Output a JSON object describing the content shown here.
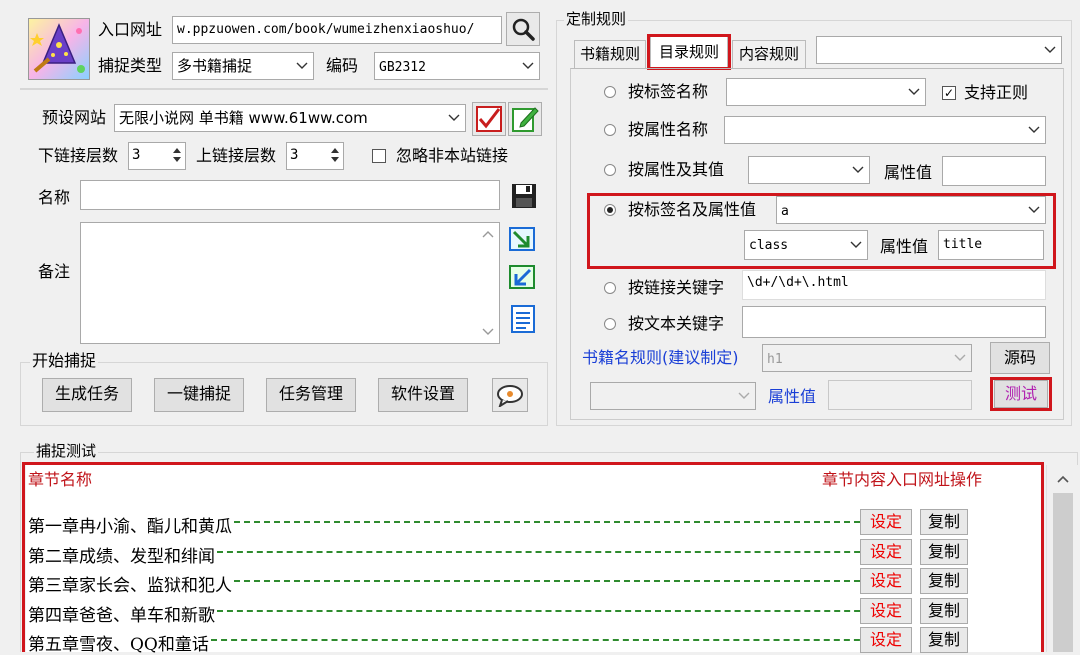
{
  "left": {
    "url_label": "入口网址",
    "url_value": "w.ppzuowen.com/book/wumeizhenxiaoshuo/",
    "capture_type_label": "捕捉类型",
    "capture_type_value": "多书籍捕捉",
    "encoding_label": "编码",
    "encoding_value": "GB2312",
    "preset_label": "预设网站",
    "preset_value": "无限小说网 单书籍 www.61ww.com",
    "down_depth_label": "下链接层数",
    "down_depth_value": "3",
    "up_depth_label": "上链接层数",
    "up_depth_value": "3",
    "ignore_offsite_label": "忽略非本站链接",
    "name_label": "名称",
    "name_value": "",
    "notes_label": "备注",
    "start_group_label": "开始捕捉",
    "buttons": {
      "generate": "生成任务",
      "one_click": "一键捕捉",
      "task_mgmt": "任务管理",
      "settings": "软件设置"
    }
  },
  "rules": {
    "group_label": "定制规则",
    "tabs": [
      "书籍规则",
      "目录规则",
      "内容规则"
    ],
    "active_tab": 1,
    "tab_combo_value": "",
    "by_tag_name": "按标签名称",
    "support_regex": "支持正则",
    "by_attr_name": "按属性名称",
    "by_attr_and_value": "按属性及其值",
    "attr_value_label": "属性值",
    "by_tag_and_attr": "按标签名及属性值",
    "tag_value": "a",
    "attr_name_value": "class",
    "attr_value_value": "title",
    "by_link_keyword": "按链接关键字",
    "link_keyword_value": "\\d+/\\d+\\.html",
    "by_text_keyword": "按文本关键字",
    "text_keyword_value": "",
    "book_name_rule_label": "书籍名规则(建议制定)",
    "book_name_rule_value": "h1",
    "book_attr_value_label": "属性值",
    "source_button": "源码",
    "test_button": "测试"
  },
  "test": {
    "group_label": "捕捉测试",
    "header_left": "章节名称",
    "header_right": "章节内容入口网址操作",
    "set_label": "设定",
    "copy_label": "复制",
    "rows": [
      "第一章冉小渝、酯儿和黄瓜",
      "第二章成绩、发型和绯闻",
      "第三章家长会、监狱和犯人",
      "第四章爸爸、单车和新歌",
      "第五章雪夜、QQ和童话"
    ]
  },
  "colors": {
    "highlight_red": "#d0161c",
    "link_blue": "#1a3fd6",
    "header_red": "#c0141a",
    "dash_green": "#2e8b2e"
  }
}
